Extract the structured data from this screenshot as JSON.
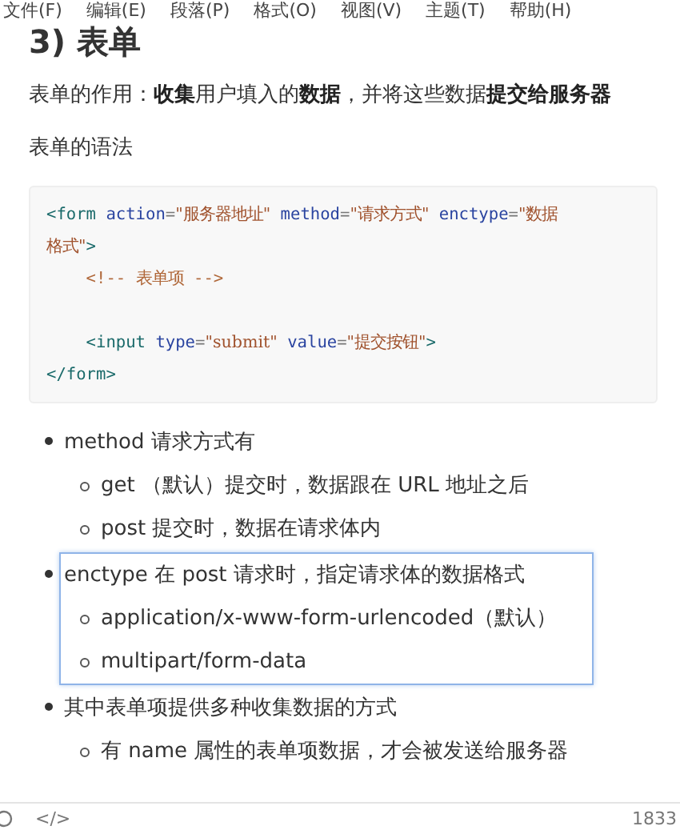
{
  "menu_bar": [
    "文件(F)",
    "编辑(E)",
    "段落(P)",
    "格式(O)",
    "视图(V)",
    "主题(T)",
    "帮助(H)"
  ],
  "heading": "3) 表单",
  "paragraphs": [
    "表单的作用：**收集**用户填入的**数据**，并将这些数据**提交给服务器**",
    "表单的语法"
  ],
  "code_block": {
    "lines": [
      {
        "space_before": false,
        "tokens": [
          {
            "kind": "tag",
            "text": "<form"
          },
          {
            "kind": "attr",
            "text": "action"
          },
          {
            "kind": "punct",
            "text": "="
          },
          {
            "kind": "string",
            "text": "\"服务器地址\""
          },
          {
            "kind": "attr",
            "text": "method"
          },
          {
            "kind": "punct",
            "text": "="
          },
          {
            "kind": "string",
            "text": "\"请求方式\""
          },
          {
            "kind": "attr",
            "text": "enctype"
          },
          {
            "kind": "punct",
            "text": "="
          },
          {
            "kind": "string",
            "text": "\"数据"
          }
        ]
      },
      {
        "space_before": false,
        "tokens": [
          {
            "kind": "string",
            "text": "格式\""
          },
          {
            "kind": "tag",
            "text": ">"
          }
        ]
      },
      {
        "space_before": false,
        "tokens": [
          {
            "kind": "comment",
            "text": "    <!-- 表单项 -->"
          }
        ]
      },
      {
        "space_before": true,
        "tokens": [
          {
            "kind": "tag",
            "text": "    <input"
          },
          {
            "kind": "attr",
            "text": "type"
          },
          {
            "kind": "punct",
            "text": "="
          },
          {
            "kind": "string",
            "text": "\"submit\""
          },
          {
            "kind": "attr",
            "text": "value"
          },
          {
            "kind": "punct",
            "text": "="
          },
          {
            "kind": "string",
            "text": "\"提交按钮\""
          },
          {
            "kind": "tag",
            "text": ">"
          }
        ]
      },
      {
        "space_before": false,
        "tokens": [
          {
            "kind": "tag",
            "text": "</form>"
          }
        ]
      }
    ]
  },
  "list": [
    {
      "text": "method 请求方式有",
      "highlighted": false,
      "children": [
        {
          "text": "get （默认）提交时，数据跟在 URL 地址之后"
        },
        {
          "text": "post 提交时，数据在请求体内"
        }
      ]
    },
    {
      "text": "enctype 在 post 请求时，指定请求体的数据格式",
      "highlighted": true,
      "children": [
        {
          "text": "application/x-www-form-urlencoded（默认）"
        },
        {
          "text": "multipart/form-data"
        }
      ]
    },
    {
      "text": "其中表单项提供多种收集数据的方式",
      "highlighted": false,
      "children": [
        {
          "text": "有 name 属性的表单项数据，才会被发送给服务器"
        }
      ]
    }
  ],
  "status_bar": {
    "source_toggle": "</>",
    "word_count": "1833"
  }
}
